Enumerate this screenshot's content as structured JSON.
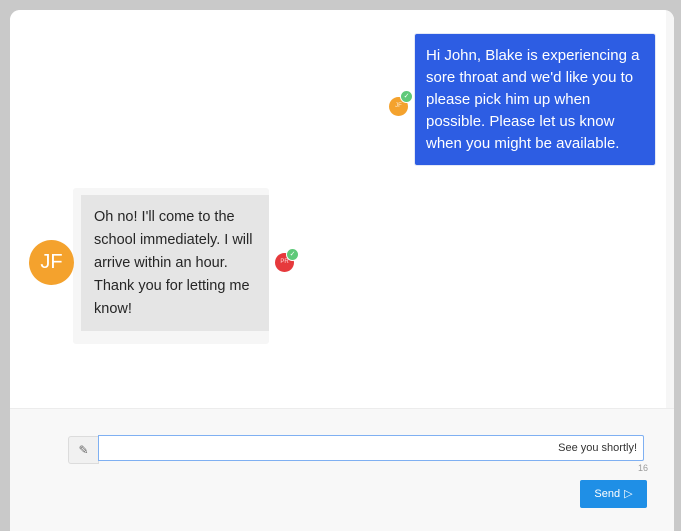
{
  "conversation": {
    "sent_message": {
      "text": "Hi John, Blake is experiencing a sore throat and we'd like you to please pick him up when possible. Please let us know when you might be available.",
      "avatar_initials": "JF",
      "read_mark": "✓"
    },
    "received_message": {
      "text": "Oh no! I'll come to the school immediately. I will arrive within an hour. Thank you for letting me know!",
      "avatar_initials": "JF",
      "read_avatar_initials": "PR",
      "read_mark": "✓"
    }
  },
  "composer": {
    "attach_icon": "paperclip-icon",
    "attach_glyph": "✎",
    "input_value": "See you shortly!",
    "char_count": "16",
    "send_label": "Send",
    "send_icon": "send-arrow-icon",
    "send_glyph": "▷"
  },
  "colors": {
    "sent_bubble": "#2d5de3",
    "received_bubble": "#e5e5e5",
    "avatar_jf": "#f4a22d",
    "avatar_pr": "#e6393c",
    "read_check": "#5fc979",
    "send_button": "#1f8fe6"
  }
}
